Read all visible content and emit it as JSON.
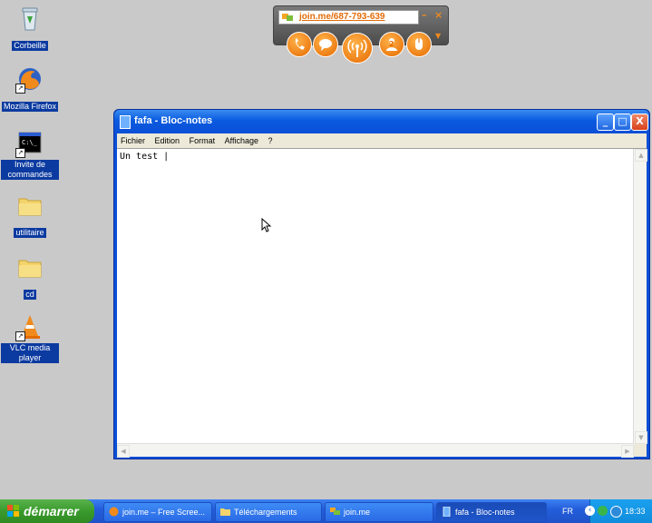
{
  "desktop": {
    "icons": [
      {
        "label": "Corbeille"
      },
      {
        "label": "Mozilla Firefox"
      },
      {
        "label": "Invite de commandes"
      },
      {
        "label": "utilitaire"
      },
      {
        "label": "cd"
      },
      {
        "label": "VLC media player"
      }
    ]
  },
  "joinme": {
    "url": "join.me/687-793-639",
    "minimize": "–",
    "close": "×",
    "buttons": [
      "phone-icon",
      "chat-icon",
      "broadcast-icon",
      "participants-icon",
      "mouse-icon"
    ],
    "participants_count": "2"
  },
  "notepad": {
    "title": "fafa - Bloc-notes",
    "menu": [
      "Fichier",
      "Edition",
      "Format",
      "Affichage",
      "?"
    ],
    "content": "Un test |",
    "controls": {
      "minimize": "_",
      "maximize": "□",
      "close": "X"
    }
  },
  "taskbar": {
    "start_label": "démarrer",
    "tasks": [
      {
        "label": "join.me – Free Scree..."
      },
      {
        "label": "Téléchargements"
      },
      {
        "label": "join.me"
      },
      {
        "label": "fafa - Bloc-notes",
        "active": true
      }
    ],
    "language": "FR",
    "clock": "18:33"
  },
  "colors": {
    "joinme_orange": "#e56a00",
    "xp_blue": "#245edb",
    "start_green": "#3a9a2c",
    "selection_blue": "#0b3aa0"
  }
}
